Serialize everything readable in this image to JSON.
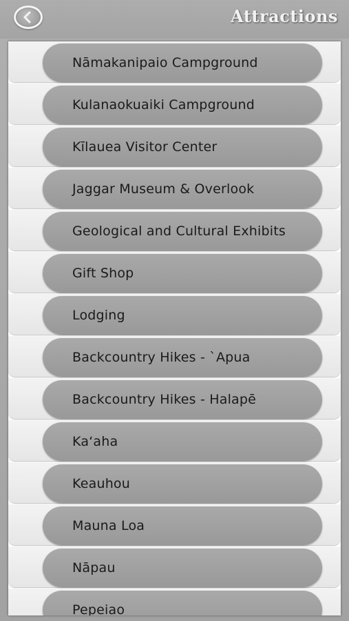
{
  "header": {
    "title": "Attractions",
    "back_icon": "chevron-left-circle-icon"
  },
  "items": [
    {
      "label": "Nāmakanipaio Campground"
    },
    {
      "label": "Kulanaokuaiki Campground"
    },
    {
      "label": "Kīlauea Visitor Center"
    },
    {
      "label": "Jaggar Museum & Overlook"
    },
    {
      "label": "Geological and Cultural Exhibits"
    },
    {
      "label": "Gift Shop"
    },
    {
      "label": "Lodging"
    },
    {
      "label": "Backcountry Hikes - `Apua"
    },
    {
      "label": "Backcountry Hikes - Halapē"
    },
    {
      "label": "Ka‘aha"
    },
    {
      "label": "Keauhou"
    },
    {
      "label": "Mauna Loa"
    },
    {
      "label": "Nāpau"
    },
    {
      "label": "Pepeiao"
    }
  ],
  "colors": {
    "background": "#a3a3a3",
    "pill": "#a3a3a3",
    "row_background": "#ececec",
    "title_text": "#f2f2f2",
    "item_text": "#1a1a1a"
  }
}
